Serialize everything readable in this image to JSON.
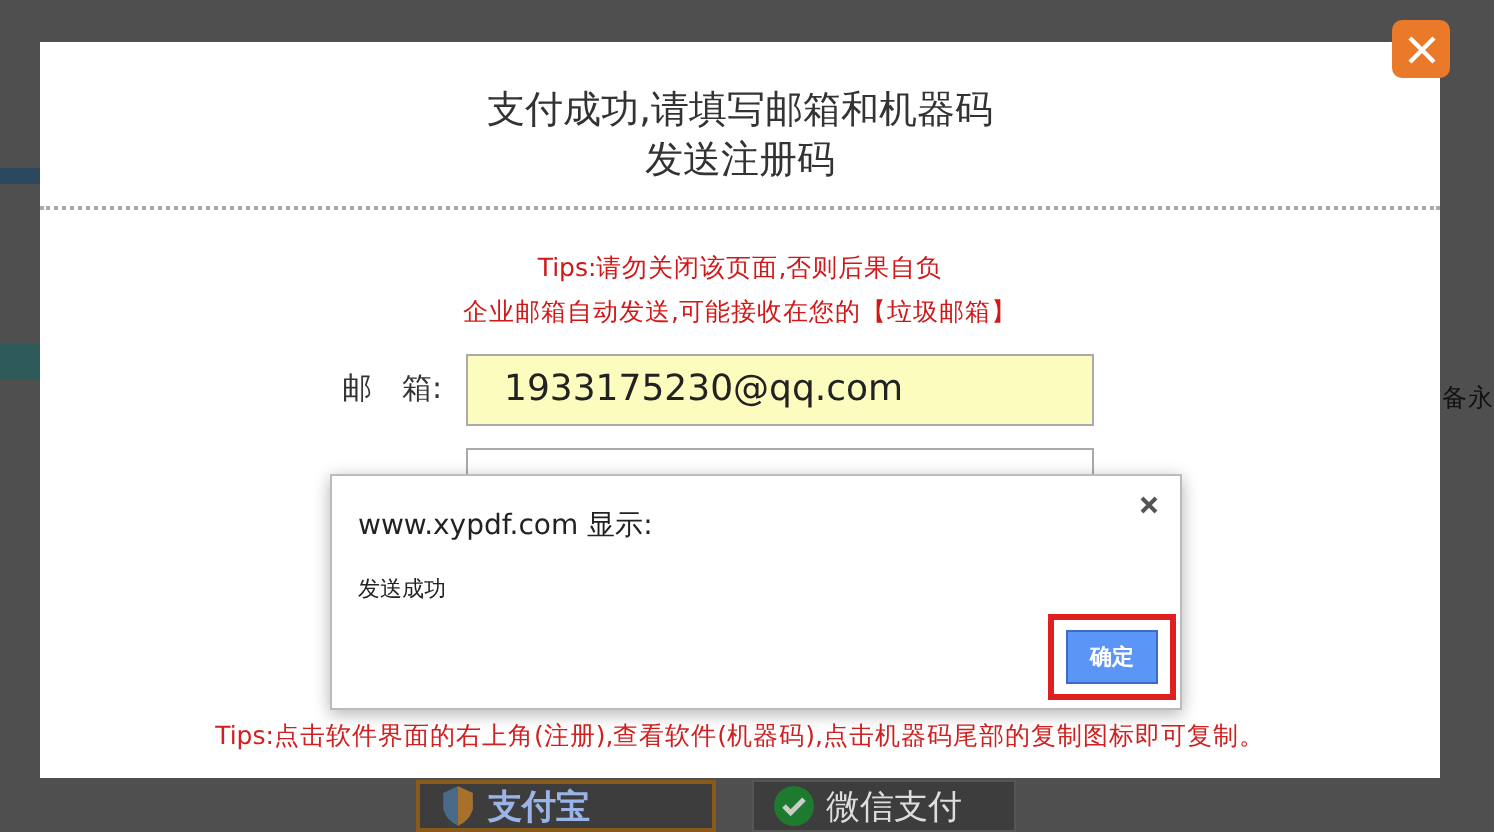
{
  "background_page": {
    "side_text": "备永",
    "payment_buttons": [
      {
        "kind": "alipay",
        "label": "支付宝"
      },
      {
        "kind": "wechat",
        "label": "微信支付"
      }
    ]
  },
  "dialog": {
    "title_lines": [
      "支付成功,请填写邮箱和机器码",
      "发送注册码"
    ],
    "tips": [
      "Tips:请勿关闭该页面,否则后果自负",
      "企业邮箱自动发送,可能接收在您的【垃圾邮箱】"
    ],
    "fields": [
      {
        "label": "邮　箱:",
        "value": "1933175230@qq.com",
        "highlighted": true
      },
      {
        "highlighted": false
      }
    ],
    "bottom_tip": "Tips:点击软件界面的右上角(注册),查看软件(机器码),点击机器码尾部的复制图标即可复制。"
  },
  "alert": {
    "title": "www.xypdf.com 显示:",
    "message": "发送成功",
    "button": "确定",
    "button_outlined": true
  }
}
